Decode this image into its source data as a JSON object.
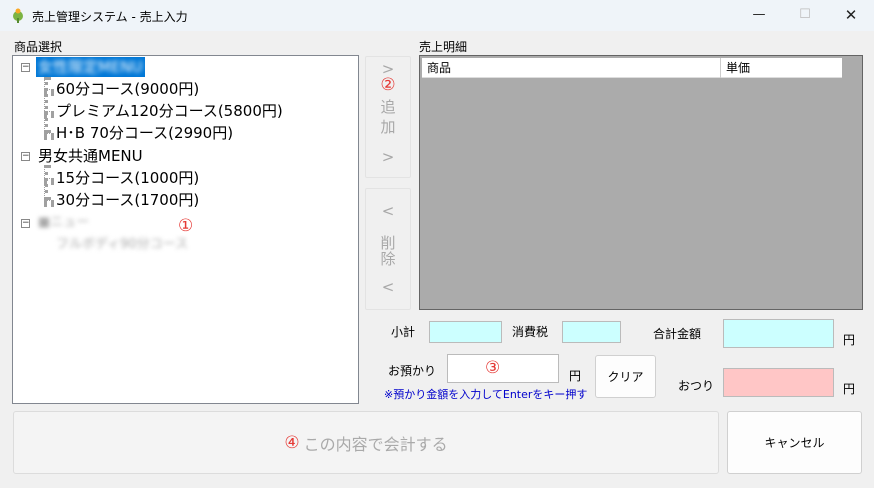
{
  "window": {
    "title": "売上管理システム - 売上入力",
    "minimize_icon": "—",
    "maximize_icon": "☐",
    "close_icon": "✕"
  },
  "product_section": {
    "label": "商品選択",
    "tree": [
      {
        "label": "女性限定MENU",
        "toggle": "−",
        "children": [
          "60分コース(9000円)",
          "プレミアム120分コース(5800円)",
          "H･B 70分コース(2990円)"
        ]
      },
      {
        "label": "男女共通MENU",
        "toggle": "−",
        "children": [
          "15分コース(1000円)",
          "30分コース(1700円)"
        ]
      },
      {
        "label": "■ニュー",
        "toggle": "−",
        "children": [
          "フルボディ90分コース"
        ]
      }
    ]
  },
  "add_button": {
    "arrow_top": ">",
    "chars": [
      "追",
      "加"
    ],
    "arrow_bottom": ">",
    "marker": "②"
  },
  "delete_button": {
    "arrow_top": "<",
    "chars": [
      "削",
      "除"
    ],
    "arrow_bottom": "<"
  },
  "sales_detail": {
    "label": "売上明細",
    "columns": [
      "商品",
      "単価"
    ]
  },
  "totals": {
    "subtotal_label": "小計",
    "tax_label": "消費税",
    "total_label": "合計金額",
    "yen": "円"
  },
  "payment": {
    "deposit_label": "お預かり",
    "yen": "円",
    "hint": "※預かり金額を入力してEnterをキー押す",
    "clear_button": "クリア",
    "change_label": "おつり",
    "marker": "③"
  },
  "actions": {
    "checkout_button": "この内容で会計する",
    "checkout_marker": "④",
    "cancel_button": "キャンセル"
  },
  "markers": {
    "tree": "①"
  }
}
